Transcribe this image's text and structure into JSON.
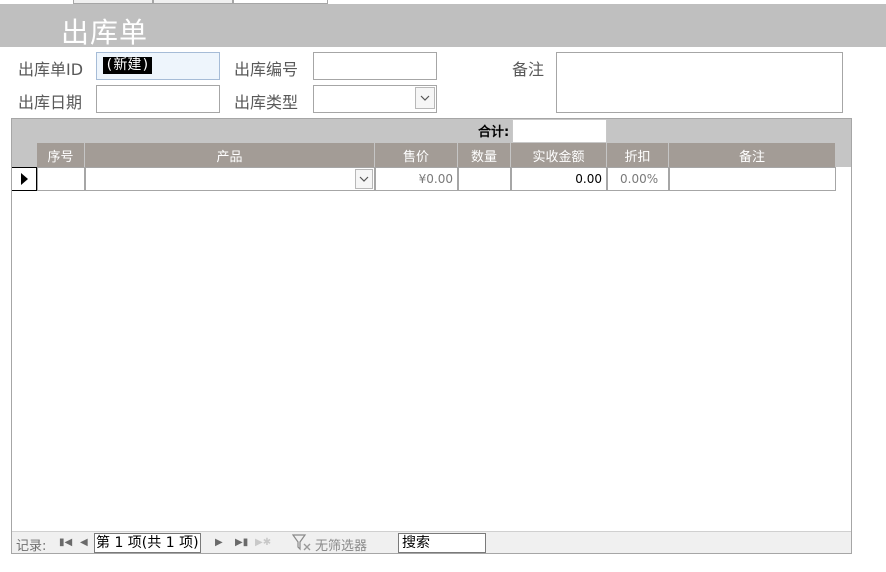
{
  "form": {
    "title": "出库单",
    "labels": {
      "id": "出库单ID",
      "number": "出库编号",
      "date": "出库日期",
      "type": "出库类型",
      "remark": "备注"
    },
    "values": {
      "id": "(新建)",
      "number": "",
      "date": "",
      "type": "",
      "remark": ""
    }
  },
  "subform": {
    "total_label": "合计:",
    "total_value": "",
    "columns": [
      "序号",
      "产品",
      "售价",
      "数量",
      "实收金额",
      "折扣",
      "备注"
    ],
    "new_row": {
      "seq": "",
      "product": "",
      "price": "¥0.00",
      "qty": "",
      "amount": "0.00",
      "discount": "0.00%",
      "remark": ""
    }
  },
  "nav": {
    "record_label": "记录:",
    "record_position": "第 1 项(共 1 项)",
    "filter_label": "无筛选器",
    "search_value": "搜索"
  },
  "icons": [
    "first-record-icon",
    "prev-record-icon",
    "next-record-icon",
    "last-record-icon",
    "new-record-icon",
    "filter-off-icon",
    "dropdown-arrow-icon",
    "row-selector-icon"
  ]
}
